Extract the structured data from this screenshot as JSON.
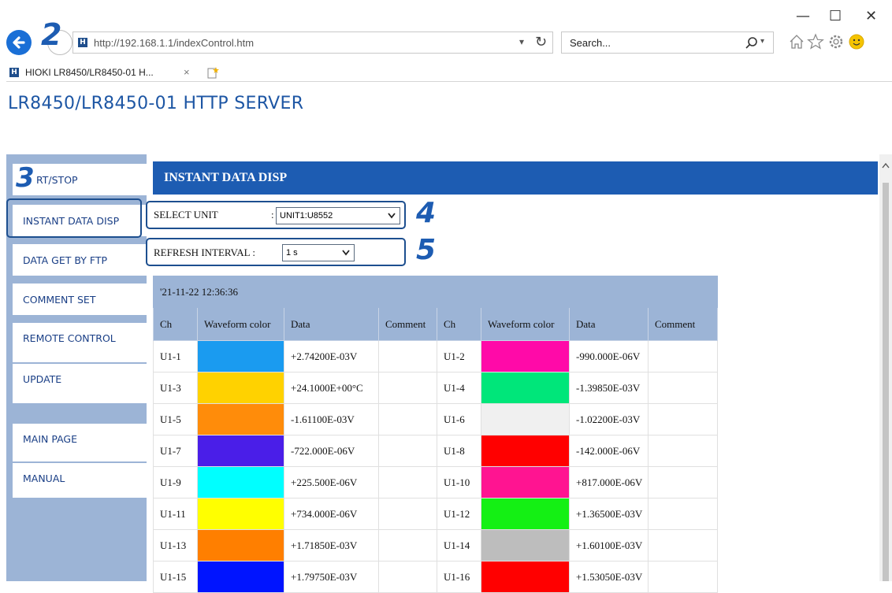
{
  "browser": {
    "url": "http://192.168.1.1/indexControl.htm",
    "search_placeholder": "Search...",
    "tab_title": "HIOKI LR8450/LR8450-01 H...",
    "tab_close": "×",
    "favicon_letter": "H",
    "minimize": "—",
    "maximize": "☐",
    "close": "✕",
    "dropdown_glyph": "▾",
    "refresh_glyph": "↻"
  },
  "page": {
    "title": "LR8450/LR8450-01 HTTP SERVER"
  },
  "sidebar": {
    "items": [
      {
        "label": "RT/STOP"
      },
      {
        "label": "INSTANT DATA DISP"
      },
      {
        "label": "DATA GET BY FTP"
      },
      {
        "label": "COMMENT SET"
      },
      {
        "label": "REMOTE CONTROL"
      },
      {
        "label": "UPDATE"
      },
      {
        "label": "MAIN PAGE"
      },
      {
        "label": "MANUAL"
      }
    ]
  },
  "main": {
    "section_title": "INSTANT DATA DISP",
    "select_unit_label": "SELECT UNIT",
    "select_unit_colon": ":",
    "select_unit_value": "UNIT1:U8552",
    "refresh_label": "REFRESH INTERVAL :",
    "refresh_value": "1 s"
  },
  "callouts": {
    "n2": "2",
    "n3": "3",
    "n4": "4",
    "n5": "5"
  },
  "table": {
    "timestamp": "'21-11-22 12:36:36",
    "headers": [
      "Ch",
      "Waveform color",
      "Data",
      "Comment",
      "Ch",
      "Waveform color",
      "Data",
      "Comment"
    ],
    "rows": [
      {
        "ch1": "U1-1",
        "c1": "#1a9bf0",
        "d1": "+2.74200E-03V",
        "cm1": "",
        "ch2": "U1-2",
        "c2": "#ff0aa8",
        "d2": "-990.000E-06V",
        "cm2": ""
      },
      {
        "ch1": "U1-3",
        "c1": "#ffd200",
        "d1": "+24.1000E+00°C",
        "cm1": "",
        "ch2": "U1-4",
        "c2": "#00e67a",
        "d2": "-1.39850E-03V",
        "cm2": ""
      },
      {
        "ch1": "U1-5",
        "c1": "#ff8c0a",
        "d1": "-1.61100E-03V",
        "cm1": "",
        "ch2": "U1-6",
        "c2": "#f0f0f0",
        "d2": "-1.02200E-03V",
        "cm2": ""
      },
      {
        "ch1": "U1-7",
        "c1": "#4a1ee8",
        "d1": "-722.000E-06V",
        "cm1": "",
        "ch2": "U1-8",
        "c2": "#ff0000",
        "d2": "-142.000E-06V",
        "cm2": ""
      },
      {
        "ch1": "U1-9",
        "c1": "#00ffff",
        "d1": "+225.500E-06V",
        "cm1": "",
        "ch2": "U1-10",
        "c2": "#ff1491",
        "d2": "+817.000E-06V",
        "cm2": ""
      },
      {
        "ch1": "U1-11",
        "c1": "#ffff00",
        "d1": "+734.000E-06V",
        "cm1": "",
        "ch2": "U1-12",
        "c2": "#14f014",
        "d2": "+1.36500E-03V",
        "cm2": ""
      },
      {
        "ch1": "U1-13",
        "c1": "#ff7f00",
        "d1": "+1.71850E-03V",
        "cm1": "",
        "ch2": "U1-14",
        "c2": "#bdbdbd",
        "d2": "+1.60100E-03V",
        "cm2": ""
      },
      {
        "ch1": "U1-15",
        "c1": "#0014ff",
        "d1": "+1.79750E-03V",
        "cm1": "",
        "ch2": "U1-16",
        "c2": "#ff0000",
        "d2": "+1.53050E-03V",
        "cm2": ""
      }
    ]
  },
  "colors": {
    "accent": "#1d5cb2",
    "sidebar_bg": "#9cb4d6",
    "title_text": "#1d56a4"
  }
}
